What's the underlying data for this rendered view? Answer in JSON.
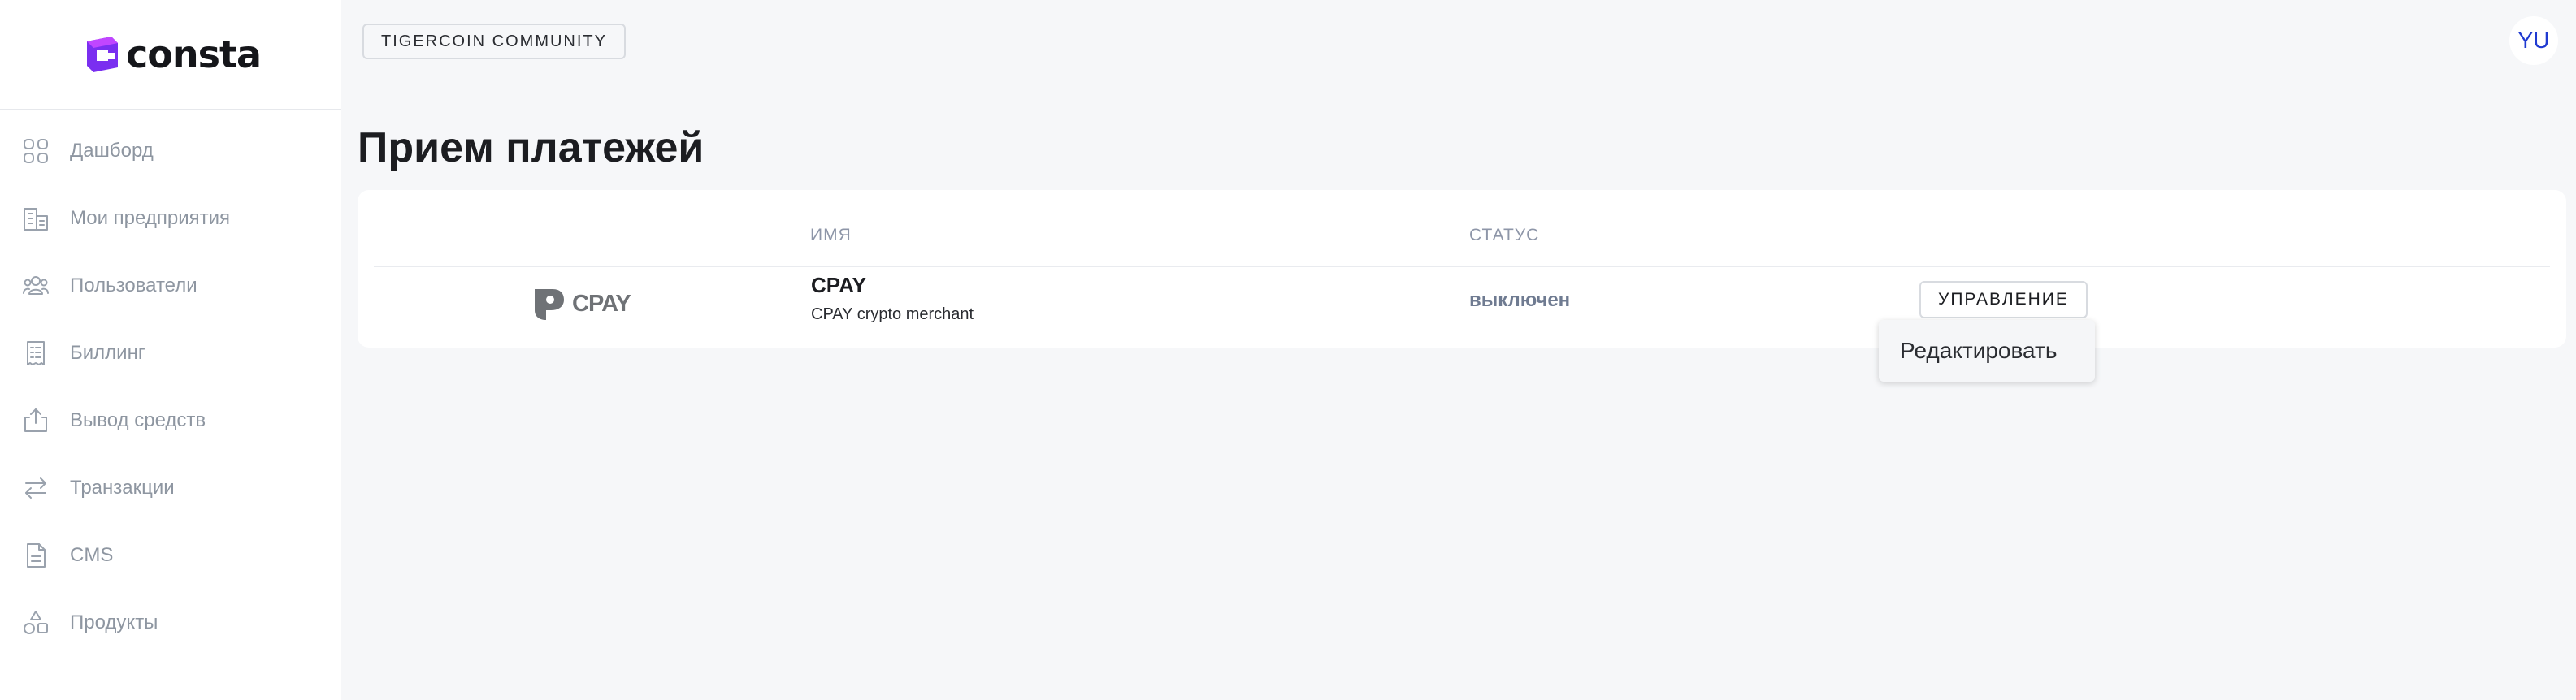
{
  "brand": {
    "name": "consta",
    "colors": {
      "logo_purple": "#8a2be2",
      "logo_violet": "#5b2ed9"
    }
  },
  "sidebar": {
    "items": [
      {
        "label": "Дашборд",
        "icon": "grid-icon"
      },
      {
        "label": "Мои предприятия",
        "icon": "buildings-icon"
      },
      {
        "label": "Пользователи",
        "icon": "users-icon"
      },
      {
        "label": "Биллинг",
        "icon": "receipt-icon"
      },
      {
        "label": "Вывод средств",
        "icon": "upload-icon"
      },
      {
        "label": "Транзакции",
        "icon": "arrows-icon"
      },
      {
        "label": "CMS",
        "icon": "document-icon"
      },
      {
        "label": "Продукты",
        "icon": "shapes-icon"
      }
    ]
  },
  "header": {
    "community": "TIGERCOIN COMMUNITY",
    "avatar": "YU"
  },
  "page": {
    "title": "Прием платежей"
  },
  "table": {
    "columns": {
      "name": "ИМЯ",
      "status": "СТАТУС"
    },
    "rows": [
      {
        "logo_text": "CPAY",
        "name": "CPAY",
        "description": "CPAY crypto merchant",
        "status": "выключен",
        "action": "УПРАВЛЕНИЕ"
      }
    ]
  },
  "dropdown": {
    "items": [
      "Редактировать"
    ]
  }
}
